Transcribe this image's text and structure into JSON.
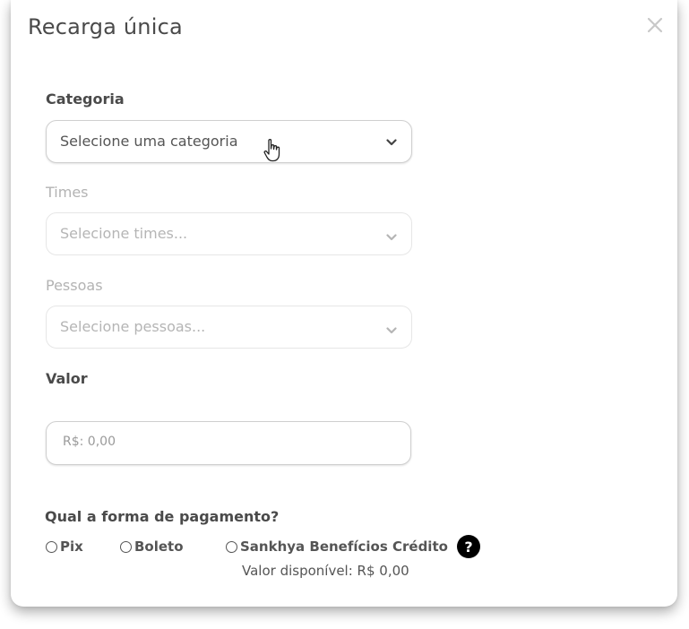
{
  "modal": {
    "title": "Recarga única"
  },
  "fields": {
    "category": {
      "label": "Categoria",
      "value": "Selecione uma categoria"
    },
    "teams": {
      "label": "Times",
      "value": "Selecione times..."
    },
    "people": {
      "label": "Pessoas",
      "value": "Selecione pessoas..."
    },
    "amount": {
      "label": "Valor",
      "placeholder": "R$: 0,00"
    }
  },
  "payment": {
    "question": "Qual a forma de pagamento?",
    "options": [
      "Pix",
      "Boleto",
      "Sankhya Benefícios Crédito"
    ],
    "help_symbol": "?",
    "available_balance": "Valor disponível: R$ 0,00"
  },
  "icons": {
    "close": "close-icon",
    "chevron": "chevron-down-icon",
    "cursor": "hand-pointer-icon",
    "help": "question-circle-icon"
  }
}
